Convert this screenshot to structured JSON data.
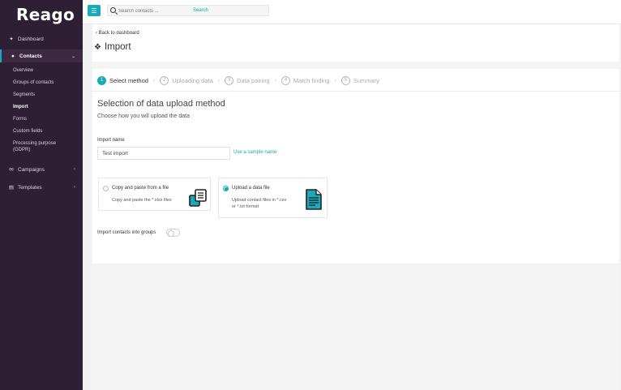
{
  "brand": {
    "logo": "Reago",
    "accent": "#19a9b8",
    "sidebar_bg": "#2e1f34"
  },
  "sidebar": {
    "dashboard": {
      "icon": "pin-icon",
      "label": "Dashboard"
    },
    "contacts": {
      "icon": "users-icon",
      "label": "Contacts"
    },
    "contacts_items": [
      "Overview",
      "Groups of contacts",
      "Segments",
      "Import",
      "Forms",
      "Custom fields",
      "Processing purpose",
      "(GDPR)"
    ],
    "campaigns": {
      "icon": "envelope-icon",
      "label": "Campaigns"
    },
    "templates": {
      "icon": "file-icon",
      "label": "Templates"
    }
  },
  "topbar": {
    "search_placeholder": "Search contacts ...",
    "search_button": "Search"
  },
  "main": {
    "back_link": "Back to dashboard",
    "title": "Import",
    "steps": [
      {
        "num": "1",
        "label": "Select method"
      },
      {
        "num": "2",
        "label": "Uploading data"
      },
      {
        "num": "3",
        "label": "Data pairing"
      },
      {
        "num": "4",
        "label": "Match finding"
      },
      {
        "num": "5",
        "label": "Summary"
      }
    ],
    "section_title": "Selection of data upload method",
    "section_subtitle": "Choose how you will upload the data",
    "import_name_label": "Import name",
    "import_name_value": "Test import",
    "sample_link": "Use a sample name",
    "option_copy": {
      "title": "Copy and paste from a file",
      "desc": "Copy and paste the *.xlsx files"
    },
    "option_upload": {
      "title": "Upload a data file",
      "desc_1": "Upload contact files in *.csv",
      "desc_2": "or *.txt format"
    },
    "groups_toggle_label": "Import contacts into groups"
  }
}
